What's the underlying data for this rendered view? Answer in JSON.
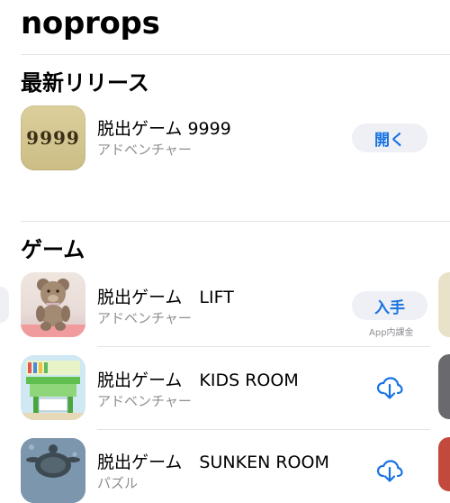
{
  "developer": {
    "name": "noprops"
  },
  "sections": {
    "latest": {
      "title": "最新リリース",
      "items": [
        {
          "name": "脱出ゲーム 9999",
          "genre": "アドベンチャー",
          "icon_text": "9999",
          "action": "開く"
        }
      ]
    },
    "games": {
      "title": "ゲーム",
      "items": [
        {
          "name": "脱出ゲーム　LIFT",
          "genre": "アドベンチャー",
          "action": "入手",
          "note": "App内課金"
        },
        {
          "name": "脱出ゲーム　KIDS ROOM",
          "genre": "アドベンチャー",
          "action_icon": "cloud-download-icon"
        },
        {
          "name": "脱出ゲーム　SUNKEN ROOM",
          "genre": "パズル",
          "action_icon": "cloud-download-icon"
        }
      ]
    }
  },
  "colors": {
    "accent": "#1773e3",
    "secondary_text": "#8e8e93",
    "separator": "#e3e3e6",
    "pill_bg": "#eff0f5"
  }
}
